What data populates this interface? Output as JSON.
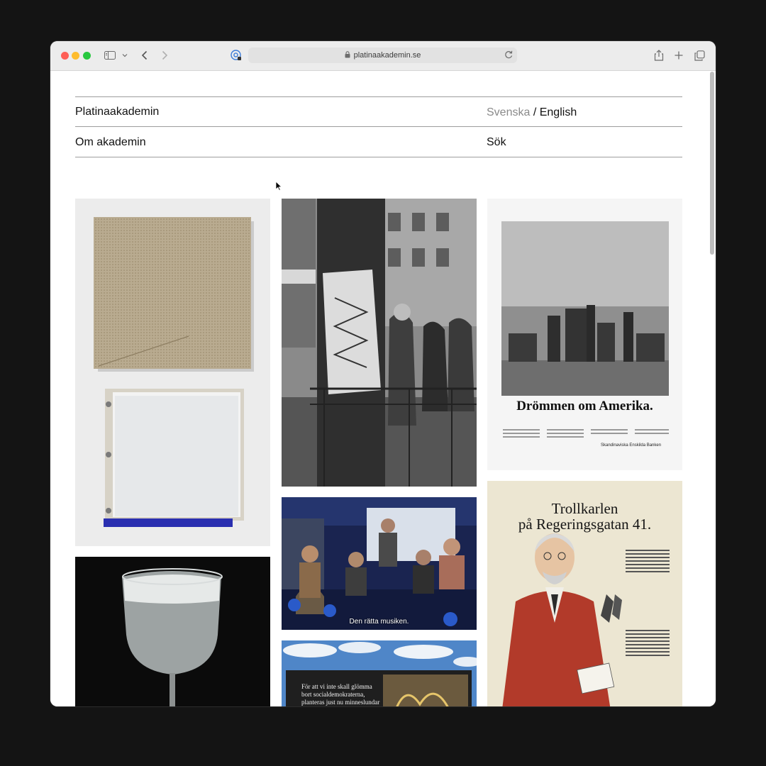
{
  "browser": {
    "url": "platinaakademin.se"
  },
  "site": {
    "title": "Platinaakademin",
    "lang_sv": "Svenska",
    "lang_sep": "/",
    "lang_en": "English",
    "nav_about": "Om akademin",
    "nav_search": "Sök"
  },
  "gallery": {
    "ad_amerika_headline": "Drömmen om Amerika.",
    "ad_amerika_bank": "Skandinaviska Enskilda Banken",
    "ad_troll_headline_1": "Trollkarlen",
    "ad_troll_headline_2": "på Regeringsgatan 41.",
    "video_subtitle": "Den rätta musiken.",
    "billboard_line_1": "För att vi inte skall glömma",
    "billboard_line_2": "bort socialdemokraterna,",
    "billboard_line_3": "planteras just nu minneslundar"
  }
}
